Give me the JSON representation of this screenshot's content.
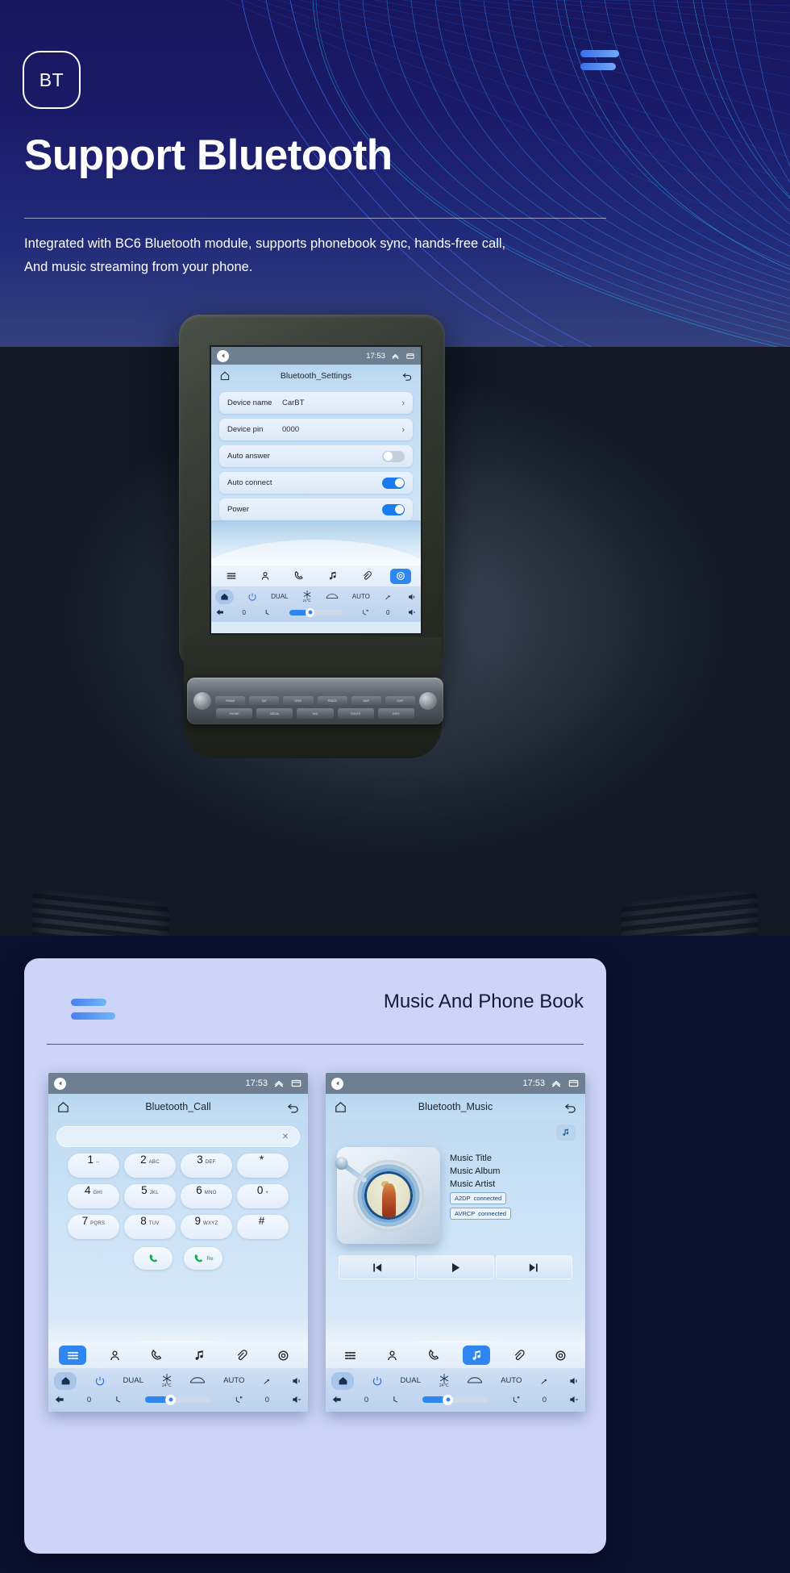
{
  "hero": {
    "badge": "BT",
    "title": "Support Bluetooth",
    "subtitle_line1": "Integrated with BC6 Bluetooth module, supports phonebook sync, hands-free call,",
    "subtitle_line2": "And music streaming from your phone.",
    "accent_color": "#3d6fe8"
  },
  "head_unit": {
    "status": {
      "time": "17:53",
      "back_icon": "back-arrow-icon",
      "up_icon": "chevron-up-icon",
      "window_icon": "window-icon"
    },
    "titlebar": {
      "home_icon": "home-icon",
      "title": "Bluetooth_Settings",
      "back_icon": "undo-icon"
    },
    "settings": [
      {
        "key": "Device name",
        "value": "CarBT",
        "control": "chevron",
        "chevron": "›"
      },
      {
        "key": "Device pin",
        "value": "0000",
        "control": "chevron",
        "chevron": "›"
      },
      {
        "key": "Auto answer",
        "value": "",
        "control": "toggle",
        "on": false
      },
      {
        "key": "Auto connect",
        "value": "",
        "control": "toggle",
        "on": true
      },
      {
        "key": "Power",
        "value": "",
        "control": "toggle",
        "on": true
      }
    ],
    "appbar": [
      {
        "icon": "apps-grid-icon",
        "active": false
      },
      {
        "icon": "contacts-person-icon",
        "active": false
      },
      {
        "icon": "phone-handset-icon",
        "active": false
      },
      {
        "icon": "music-note-icon",
        "active": false
      },
      {
        "icon": "link-attachment-icon",
        "active": false
      },
      {
        "icon": "settings-gear-icon",
        "active": true
      }
    ],
    "climate": {
      "home_icon": "home-icon",
      "power_icon": "power-icon",
      "dual_label": "DUAL",
      "snow_icon": "snowflake-icon",
      "defrost_icon": "rear-defrost-icon",
      "auto_label": "AUTO",
      "airflow_icon": "airflow-icon",
      "volume_icon": "volume-up-icon",
      "temp_label": "24℃",
      "back_icon": "back-arrow-icon",
      "left_seat_value": "0",
      "seat_icon": "seat-icon",
      "heated_seat_icon": "heated-seat-icon",
      "right_seat_value": "0",
      "volume_down_icon": "volume-down-icon",
      "fan_icon": "fan-icon"
    }
  },
  "card": {
    "title": "Music And Phone Book",
    "call_screen": {
      "status": {
        "time": "17:53"
      },
      "titlebar": {
        "home_icon": "home-icon",
        "title": "Bluetooth_Call",
        "back_icon": "undo-icon"
      },
      "search": {
        "value": "",
        "placeholder": "",
        "clear_icon": "clear-x-icon"
      },
      "dialpad": [
        {
          "num": "1",
          "sub": "--"
        },
        {
          "num": "2",
          "sub": "ABC"
        },
        {
          "num": "3",
          "sub": "DEF"
        },
        {
          "num": "*",
          "sub": ""
        },
        {
          "num": "4",
          "sub": "GHI"
        },
        {
          "num": "5",
          "sub": "JKL"
        },
        {
          "num": "6",
          "sub": "MNO"
        },
        {
          "num": "0",
          "sub": "+"
        },
        {
          "num": "7",
          "sub": "PQRS"
        },
        {
          "num": "8",
          "sub": "TUV"
        },
        {
          "num": "9",
          "sub": "WXYZ"
        },
        {
          "num": "#",
          "sub": ""
        }
      ],
      "call_button_icon": "phone-call-icon",
      "redial_button_icon": "phone-redial-icon",
      "redial_label": "Re",
      "appbar": [
        {
          "icon": "apps-grid-icon",
          "active": true
        },
        {
          "icon": "contacts-person-icon",
          "active": false
        },
        {
          "icon": "phone-handset-icon",
          "active": false
        },
        {
          "icon": "music-note-icon",
          "active": false
        },
        {
          "icon": "link-attachment-icon",
          "active": false
        },
        {
          "icon": "settings-gear-icon",
          "active": false
        }
      ]
    },
    "music_screen": {
      "status": {
        "time": "17:53"
      },
      "titlebar": {
        "home_icon": "home-icon",
        "title": "Bluetooth_Music",
        "back_icon": "undo-icon"
      },
      "note_button_icon": "music-note-icon",
      "album_art": "vinyl-record-album-art",
      "meta": {
        "title": "Music Title",
        "album": "Music Album",
        "artist": "Music Artist",
        "badges": [
          {
            "name": "A2DP",
            "status": "connected"
          },
          {
            "name": "AVRCP",
            "status": "connected"
          }
        ]
      },
      "transport": [
        {
          "icon": "previous-track-icon"
        },
        {
          "icon": "play-icon"
        },
        {
          "icon": "next-track-icon"
        }
      ],
      "appbar": [
        {
          "icon": "apps-grid-icon",
          "active": false
        },
        {
          "icon": "contacts-person-icon",
          "active": false
        },
        {
          "icon": "phone-handset-icon",
          "active": false
        },
        {
          "icon": "music-note-icon",
          "active": true
        },
        {
          "icon": "link-attachment-icon",
          "active": false
        },
        {
          "icon": "settings-gear-icon",
          "active": false
        }
      ]
    },
    "climate": {
      "dual_label": "DUAL",
      "auto_label": "AUTO",
      "temp_label": "24℃",
      "left_seat_value": "0",
      "right_seat_value": "0"
    }
  }
}
